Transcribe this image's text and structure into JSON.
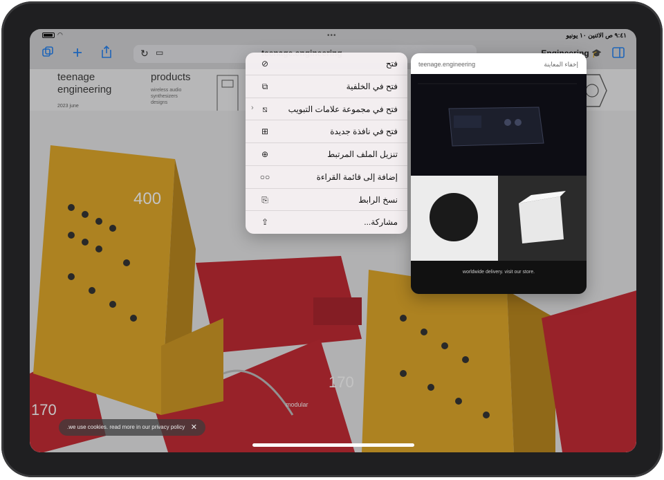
{
  "status_bar": {
    "time_date": "٩:٤١ ص  الاثنين ١٠ يونيو"
  },
  "toolbar": {
    "domain": "teenage.engineering",
    "tab_group_title": "Engineering"
  },
  "page": {
    "brand": "teenage engineering",
    "brand_date": "2023 june",
    "products_title": "products",
    "products_sub": "wireless audio synthesizers designs"
  },
  "scene_labels": {
    "tile1_number": "400",
    "tile2_number": "170",
    "tile3_number": "170",
    "module_label": "modular"
  },
  "context_menu": {
    "items": [
      {
        "label": "فتح",
        "icon": "compass-icon"
      },
      {
        "label": "فتح في الخلفية",
        "icon": "plus-square-icon"
      },
      {
        "label": "فتح في مجموعة علامات التبويب",
        "icon": "arrow-up-right-square-icon"
      },
      {
        "label": "فتح في نافذة جديدة",
        "icon": "plus-square-icon"
      },
      {
        "label": "تنزيل الملف المرتبط",
        "icon": "download-circle-icon"
      },
      {
        "label": "إضافة إلى قائمة القراءة",
        "icon": "glasses-icon"
      },
      {
        "label": "نسخ الرابط",
        "icon": "copy-doc-icon"
      },
      {
        "label": "مشاركة...",
        "icon": "share-icon"
      }
    ]
  },
  "preview": {
    "site": "teenage.engineering",
    "hide_label": "إخفاء المعاينة",
    "footer_text": "worldwide delivery. visit our store."
  },
  "cookie_banner": {
    "text": ".we use cookies. read more in our privacy policy"
  },
  "colors": {
    "accent": "#1a7cf0",
    "yellow": "#e1a61f",
    "red": "#c4202a"
  }
}
